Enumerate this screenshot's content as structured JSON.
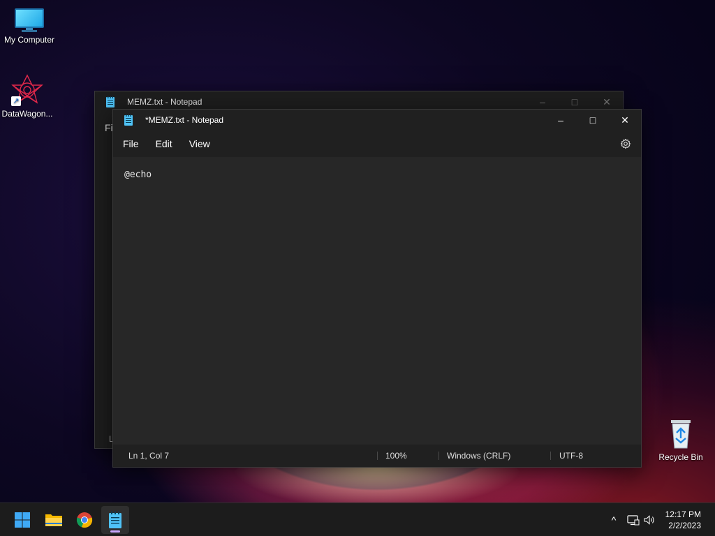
{
  "desktop": {
    "icons": [
      {
        "label": "My Computer",
        "icon": "computer-icon"
      },
      {
        "label": "DataWagon...",
        "icon": "datawagon-shortcut-icon"
      },
      {
        "label": "Recycle Bin",
        "icon": "recycle-bin-icon"
      }
    ]
  },
  "back_window": {
    "title": "MEMZ.txt - Notepad",
    "partial_menu": "Fi",
    "partial_status": "L"
  },
  "front_window": {
    "title": "*MEMZ.txt - Notepad",
    "controls": {
      "minimize": "–",
      "maximize": "□",
      "close": "✕"
    },
    "menu": {
      "file": "File",
      "edit": "Edit",
      "view": "View"
    },
    "content": "@echo",
    "status": {
      "position": "Ln 1, Col 7",
      "zoom": "100%",
      "line_ending": "Windows (CRLF)",
      "encoding": "UTF-8"
    }
  },
  "taskbar": {
    "apps": [
      {
        "name": "start-button",
        "icon": "windows-logo-icon"
      },
      {
        "name": "file-explorer",
        "icon": "folder-icon"
      },
      {
        "name": "chrome",
        "icon": "chrome-icon"
      },
      {
        "name": "notepad",
        "icon": "notepad-icon",
        "active": true
      }
    ],
    "tray": {
      "chevron": "^"
    },
    "clock": {
      "time": "12:17 PM",
      "date": "2/2/2023"
    }
  },
  "colors": {
    "accent": "#c9a6ff",
    "window_bg": "#202020",
    "editor_bg": "#272727",
    "notepad_icon": "#4fc3f7"
  }
}
